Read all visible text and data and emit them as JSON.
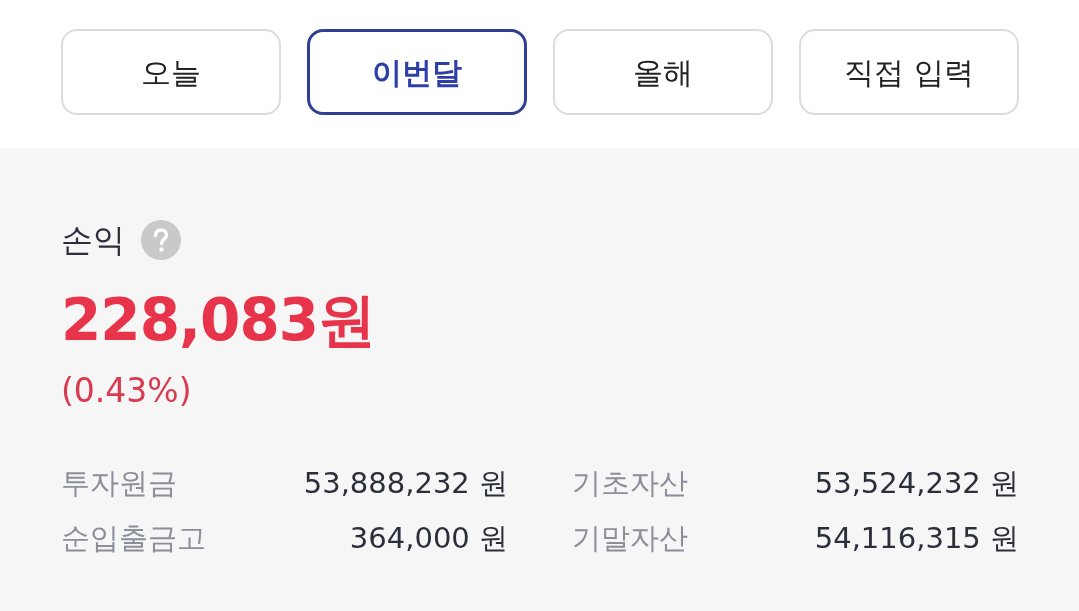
{
  "period_tabs": [
    {
      "label": "오늘",
      "selected": false
    },
    {
      "label": "이번달",
      "selected": true
    },
    {
      "label": "올해",
      "selected": false
    },
    {
      "label": "직접 입력",
      "selected": false
    }
  ],
  "profit": {
    "title": "손익",
    "amount": "228,083원",
    "rate": "(0.43%)"
  },
  "summary": [
    {
      "label": "투자원금",
      "value": "53,888,232 원"
    },
    {
      "label": "기초자산",
      "value": "53,524,232 원"
    },
    {
      "label": "순입출금고",
      "value": "364,000 원"
    },
    {
      "label": "기말자산",
      "value": "54,116,315 원"
    }
  ]
}
